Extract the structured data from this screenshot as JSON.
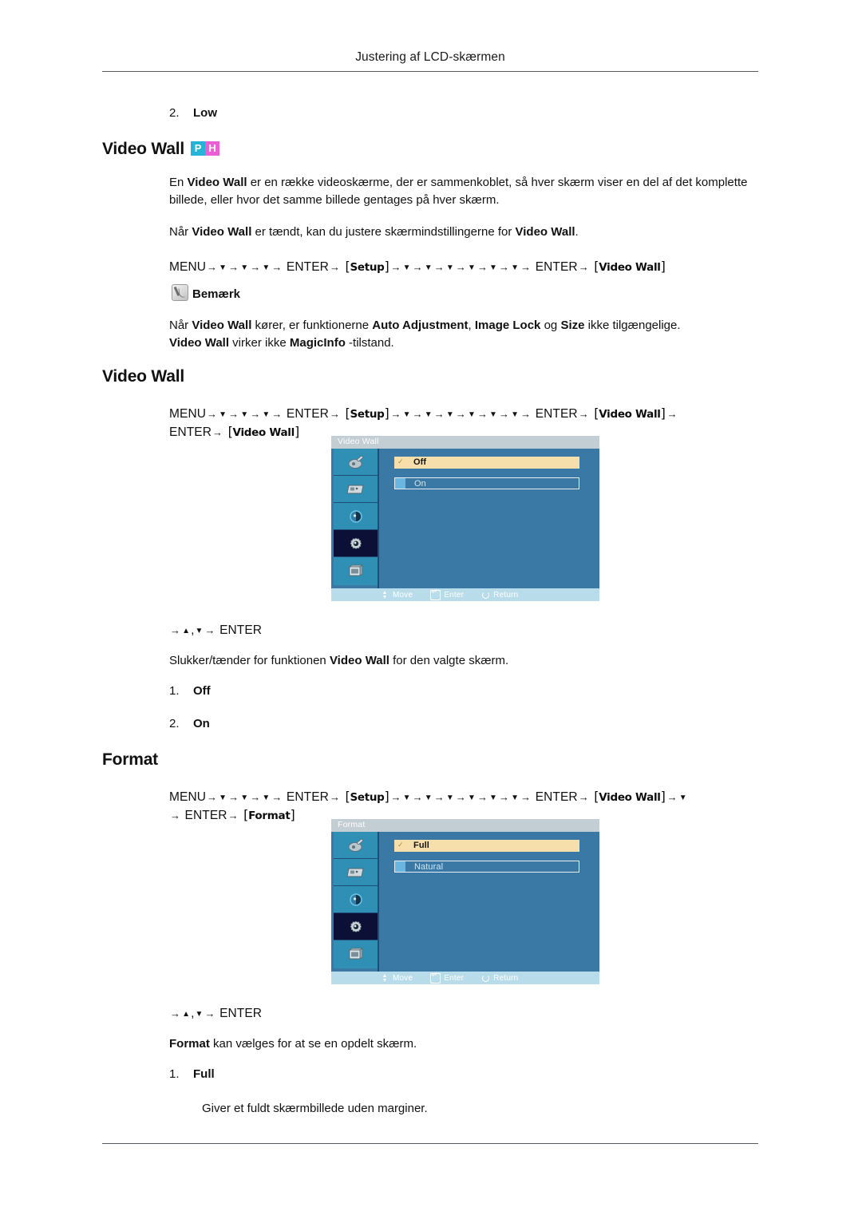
{
  "header": {
    "title": "Justering af LCD-skærmen"
  },
  "top_list_item": {
    "num": "2.",
    "label": "Low"
  },
  "section_videowall": {
    "heading": "Video Wall",
    "badges": [
      {
        "name": "badge-p",
        "text": "P",
        "color": "#26b3d8"
      },
      {
        "name": "badge-h",
        "text": "H",
        "color": "#ea5fd4"
      }
    ],
    "paragraph1_a": "En ",
    "paragraph1_b": "Video Wall",
    "paragraph1_c": " er en række videoskærme, der er sammenkoblet, så hver skærm viser en del af det komplette billede, eller hvor det samme billede gentages på hver skærm.",
    "paragraph2_a": "Når ",
    "paragraph2_b": "Video Wall",
    "paragraph2_c": " er tændt, kan du justere skærmindstillingerne for ",
    "paragraph2_d": "Video Wall",
    "paragraph2_e": ".",
    "menupath": {
      "menu": "MENU",
      "enter": "ENTER",
      "setup": "Setup",
      "videowall": "Video Wall"
    }
  },
  "note": {
    "label": "Bemærk",
    "icon": "note-pencil-icon",
    "line1_a": "Når ",
    "line1_b": "Video Wall",
    "line1_c": " kører, er funktionerne ",
    "line1_d": "Auto Adjustment",
    "line1_e": ", ",
    "line1_f": "Image Lock",
    "line1_g": " og ",
    "line1_h": "Size",
    "line1_i": " ikke tilgængelige.",
    "line2_a": "Video Wall",
    "line2_b": " virker ikke ",
    "line2_c": "MagicInfo",
    "line2_d": " -tilstand."
  },
  "section_videowall2": {
    "heading": "Video Wall",
    "menupath": {
      "menu": "MENU",
      "enter": "ENTER",
      "setup": "Setup",
      "videowall": "Video Wall"
    },
    "osd": {
      "title": "Video Wall",
      "options": [
        {
          "label": "Off",
          "selected": true
        },
        {
          "label": "On",
          "selected": false
        }
      ],
      "footer": [
        {
          "icon": "move-icon",
          "label": "Move"
        },
        {
          "icon": "enter-icon",
          "label": "Enter"
        },
        {
          "icon": "return-icon",
          "label": "Return"
        }
      ],
      "sidebar_icons": [
        {
          "name": "picture-icon",
          "selected": false
        },
        {
          "name": "display-icon",
          "selected": false
        },
        {
          "name": "sound-icon",
          "selected": false
        },
        {
          "name": "setup-gear-icon",
          "selected": true
        },
        {
          "name": "multicontrol-icon",
          "selected": false
        }
      ]
    },
    "nav_hint": "ENTER",
    "description_a": "Slukker/tænder for funktionen ",
    "description_b": "Video Wall",
    "description_c": " for den valgte skærm.",
    "list": [
      {
        "num": "1.",
        "label": "Off"
      },
      {
        "num": "2.",
        "label": "On"
      }
    ]
  },
  "section_format": {
    "heading": "Format",
    "menupath": {
      "menu": "MENU",
      "enter": "ENTER",
      "setup": "Setup",
      "videowall": "Video Wall",
      "format": "Format"
    },
    "osd": {
      "title": "Format",
      "options": [
        {
          "label": "Full",
          "selected": true
        },
        {
          "label": "Natural",
          "selected": false
        }
      ],
      "footer": [
        {
          "icon": "move-icon",
          "label": "Move"
        },
        {
          "icon": "enter-icon",
          "label": "Enter"
        },
        {
          "icon": "return-icon",
          "label": "Return"
        }
      ],
      "sidebar_icons": [
        {
          "name": "picture-icon",
          "selected": false
        },
        {
          "name": "display-icon",
          "selected": false
        },
        {
          "name": "sound-icon",
          "selected": false
        },
        {
          "name": "setup-gear-icon",
          "selected": true
        },
        {
          "name": "multicontrol-icon",
          "selected": false
        }
      ]
    },
    "nav_hint": "ENTER",
    "description_a": "Format",
    "description_b": " kan vælges for at se en opdelt skærm.",
    "list": [
      {
        "num": "1.",
        "label": "Full"
      }
    ],
    "sub_description": "Giver et fuldt skærmbillede uden marginer."
  }
}
